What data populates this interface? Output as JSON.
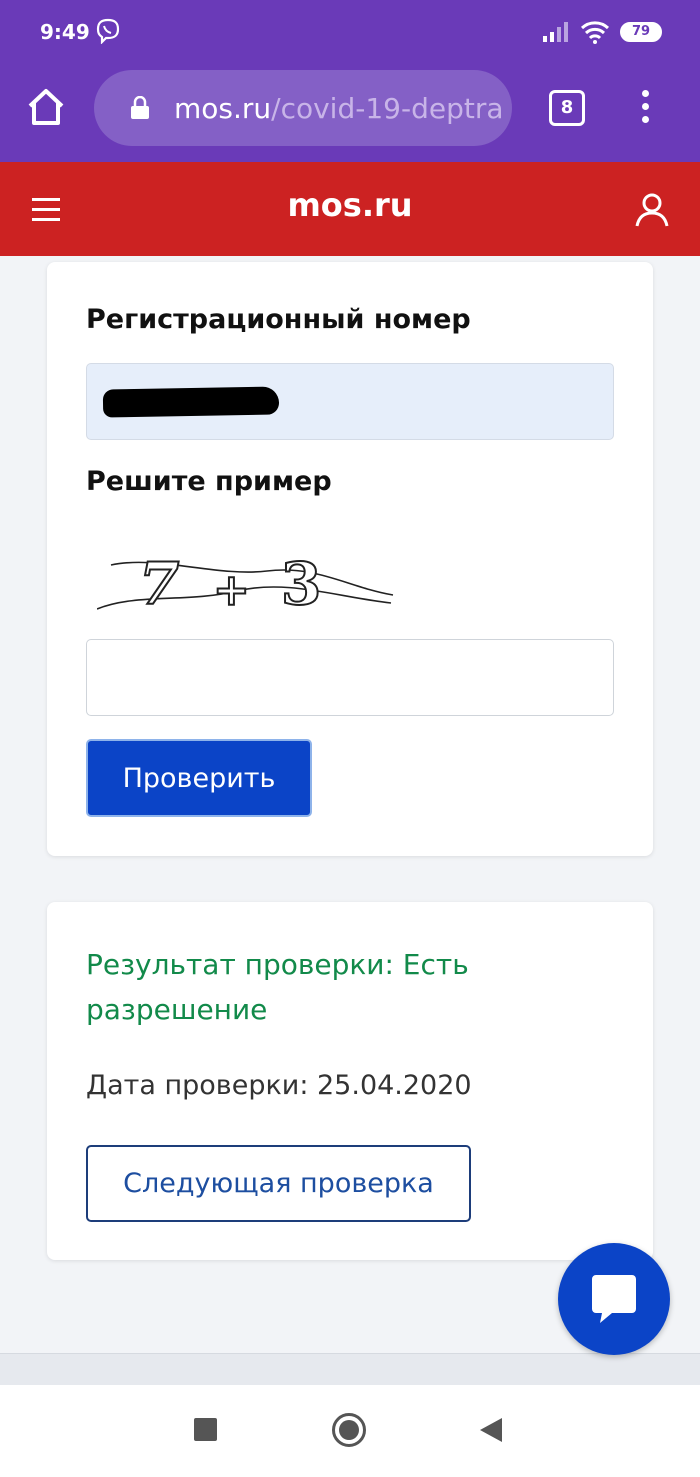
{
  "status_bar": {
    "time": "9:49",
    "battery": "79"
  },
  "browser": {
    "url_host": "mos.ru",
    "url_path": "/covid-19-deptra",
    "tab_count": "8"
  },
  "site": {
    "logo": "mos.ru"
  },
  "form": {
    "reg_label": "Регистрационный номер",
    "reg_value_redacted": true,
    "captcha_label": "Решите пример",
    "captcha": {
      "left": "7",
      "op": "+",
      "right": "3"
    },
    "answer_value": "",
    "submit_label": "Проверить"
  },
  "result": {
    "status": "Результат проверки: Есть разрешение",
    "date": "Дата проверки: 25.04.2020",
    "next_label": "Следующая проверка"
  },
  "colors": {
    "brand_red": "#cc2222",
    "browser_purple": "#6a3ab8",
    "accent_blue": "#0b44c7",
    "success_green": "#128a4a"
  }
}
